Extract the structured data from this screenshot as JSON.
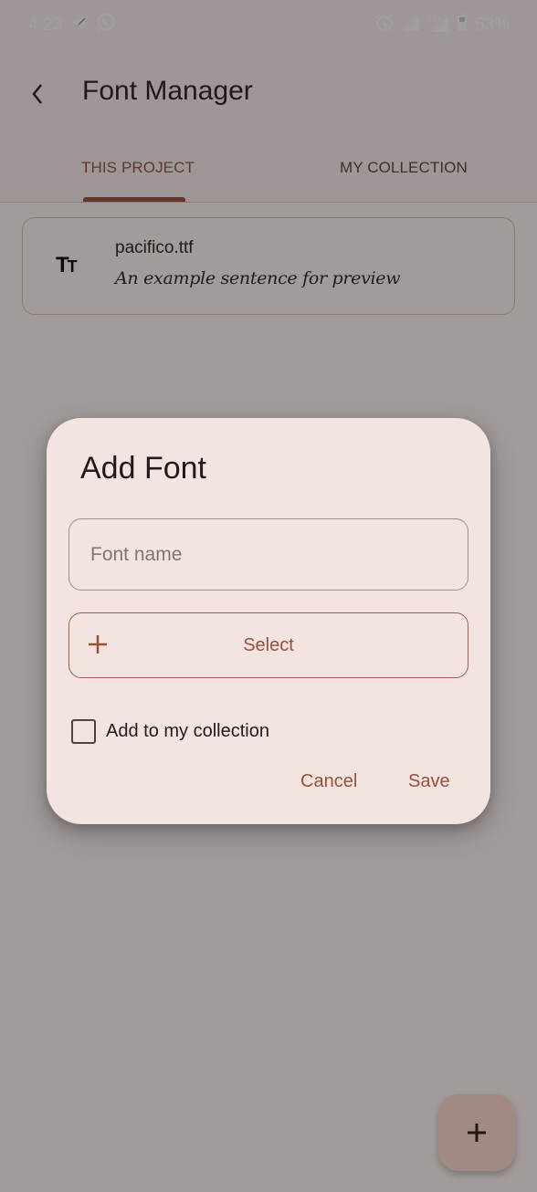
{
  "status_bar": {
    "time": "4:23",
    "notification_icons": [
      "telegram-icon",
      "whatsapp-icon"
    ],
    "system_icons": [
      "alarm-icon",
      "signal-icon",
      "signal-4g-plus-icon",
      "battery-icon"
    ],
    "network_label": "4G+",
    "battery": "53%"
  },
  "header": {
    "title": "Font Manager",
    "back_icon": "chevron-left-icon"
  },
  "tabs": [
    {
      "label": "THIS PROJECT",
      "selected": true
    },
    {
      "label": "MY COLLECTION",
      "selected": false
    }
  ],
  "fonts": [
    {
      "icon": "text-fields-icon",
      "icon_text": "Tт",
      "file_name": "pacifico.ttf",
      "preview": "An example sentence for preview"
    }
  ],
  "fab": {
    "icon": "plus-icon"
  },
  "dialog": {
    "title": "Add Font",
    "name_field": {
      "value": "",
      "placeholder": "Font name"
    },
    "select_button": {
      "label": "Select",
      "icon": "plus-icon"
    },
    "checkbox": {
      "label": "Add to my collection",
      "checked": false
    },
    "cancel_label": "Cancel",
    "save_label": "Save"
  },
  "colors": {
    "primary": "#8f4c38",
    "dialog_surface": "#f4e4e1",
    "scrim": "#201a19"
  }
}
